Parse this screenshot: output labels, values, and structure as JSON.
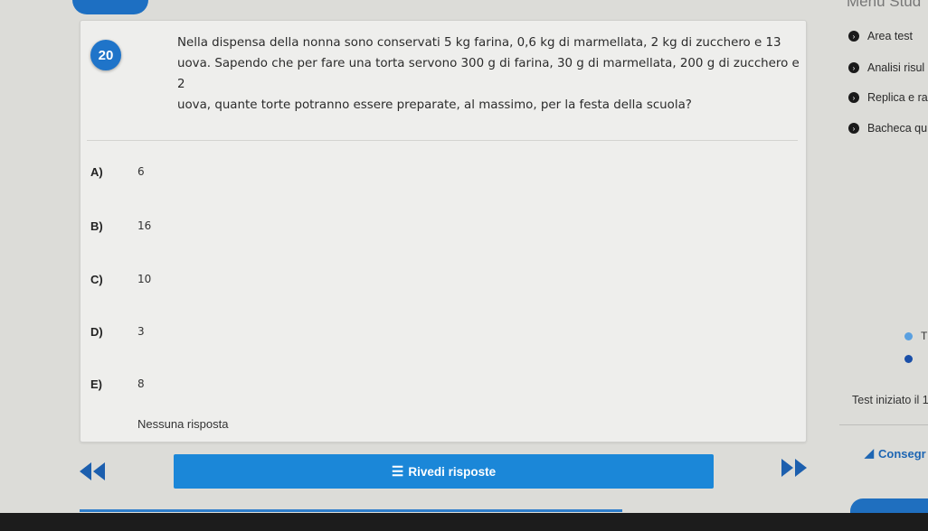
{
  "header": {
    "menu_label": "Menu Stud"
  },
  "question": {
    "number": "20",
    "line1": "Nella dispensa della nonna sono conservati 5 kg farina, 0,6 kg di marmellata, 2 kg di zucchero e 13",
    "line2": "uova. Sapendo che per fare una torta servono 300 g di farina, 30 g di marmellata, 200 g di zucchero e 2",
    "line3": "uova, quante torte potranno essere preparate, al massimo, per la festa della scuola?"
  },
  "options": [
    {
      "letter": "A)",
      "value": "6"
    },
    {
      "letter": "B)",
      "value": "16"
    },
    {
      "letter": "C)",
      "value": "10"
    },
    {
      "letter": "D)",
      "value": "3"
    },
    {
      "letter": "E)",
      "value": "8"
    }
  ],
  "no_answer_label": "Nessuna risposta",
  "review_button": {
    "label": "Rivedi risposte",
    "icon": "list-icon"
  },
  "sidebar": {
    "items": [
      {
        "label": "Area test",
        "icon": "chevron-right-circle-icon"
      },
      {
        "label": "Analisi risul",
        "icon": "chevron-right-circle-icon"
      },
      {
        "label": "Replica e ra",
        "icon": "chevron-right-circle-icon"
      },
      {
        "label": "Bacheca qu",
        "icon": "chevron-right-circle-icon"
      }
    ],
    "legend": [
      {
        "label": "T",
        "color": "#5aa0e0"
      },
      {
        "label": "",
        "color": "#1a4fa8"
      }
    ],
    "started_text": "Test iniziato il 1",
    "submit_label": "Consegr"
  },
  "colors": {
    "accent": "#1b87d8",
    "question_badge": "#1f74c9"
  }
}
